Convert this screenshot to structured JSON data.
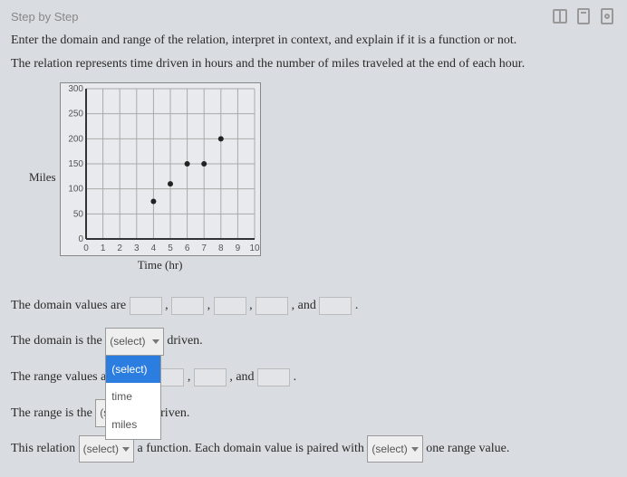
{
  "header": {
    "step": "Step by Step"
  },
  "prompt1": "Enter the domain and range of the relation, interpret in context, and explain if it is a function or not.",
  "prompt2": "The relation represents time driven in hours and the number of miles traveled at the end of each hour.",
  "ylabel": "Miles",
  "xlabel": "Time (hr)",
  "chart_data": {
    "type": "scatter",
    "xlabel": "Time (hr)",
    "ylabel": "Miles",
    "xlim": [
      0,
      10
    ],
    "ylim": [
      0,
      300
    ],
    "xticks": [
      0,
      1,
      2,
      3,
      4,
      5,
      6,
      7,
      8,
      9,
      10
    ],
    "yticks": [
      0,
      50,
      100,
      150,
      200,
      250,
      300
    ],
    "points": [
      {
        "x": 4,
        "y": 75
      },
      {
        "x": 5,
        "y": 110
      },
      {
        "x": 6,
        "y": 150
      },
      {
        "x": 7,
        "y": 150
      },
      {
        "x": 8,
        "y": 200
      }
    ]
  },
  "form": {
    "domain_values_label": "The domain values are",
    "comma": ",",
    "and": ", and",
    "period": ".",
    "domain_is_pre": "The domain is the",
    "domain_is_post": "driven.",
    "range_values_label": "The range values a",
    "range_is_pre": "The range is the",
    "range_is_post": "driven.",
    "rel_pre": "This relation",
    "rel_mid": "a function. Each domain value is paired with",
    "rel_post": "one range value.",
    "select_label": "(select)",
    "dropdown": {
      "header": "(select)",
      "opt1": "time",
      "opt2": "miles"
    }
  }
}
